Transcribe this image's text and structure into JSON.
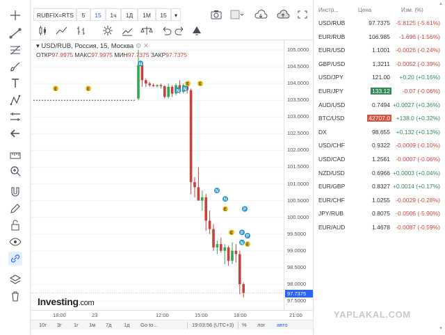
{
  "toolbar": {
    "symbol": "RUBFIX=RTS",
    "intervals": [
      "5",
      "15",
      "1ч",
      "1Д",
      "1М",
      "15"
    ],
    "selected_interval": "15"
  },
  "legend": {
    "title": "USD/RUB, Россия, 15, Москва",
    "open_label": "ОТКР",
    "open": "97.9975",
    "high_label": "МАКС",
    "high": "97.9975",
    "low_label": "МИН",
    "low": "97.7375",
    "close_label": "ЗАКР",
    "close": "97.7375"
  },
  "price_axis": {
    "ticks": [
      "105.0000",
      "104.5000",
      "104.0000",
      "103.5000",
      "103.0000",
      "102.5000",
      "102.0000",
      "101.5000",
      "101.0000",
      "100.5000",
      "100.0000",
      "99.5000",
      "99.0000",
      "98.5000",
      "98.0000",
      "97.5000"
    ],
    "current": "97.7375",
    "current_color": "#2962ff"
  },
  "time_axis": {
    "ticks": [
      "18:00",
      "23",
      "12:00",
      "15:00",
      "18:00",
      "21:00"
    ]
  },
  "bottom_bar": {
    "ranges": [
      "10г",
      "3г",
      "1г",
      "1м",
      "7д",
      "1д",
      "Go to..."
    ],
    "clock": "19:03:56 (UTC+3)",
    "percent": "%",
    "log": "лог",
    "auto": "авто"
  },
  "logo": {
    "name": "Investing",
    "suffix": ".com"
  },
  "events": [
    {
      "kind": "E",
      "color": "#f2c21b"
    },
    {
      "kind": "N",
      "color": "#2196c9"
    },
    {
      "kind": "P",
      "color": "#2196c9"
    }
  ],
  "watchlist": {
    "headers": {
      "symbol": "Инстр...",
      "price": "Цена",
      "change": "Изм. (%)"
    },
    "rows": [
      {
        "symbol": "USD/RUB",
        "price": "97.7375",
        "change": "-5.8125 (-5.61%)",
        "dir": "neg",
        "flash": ""
      },
      {
        "symbol": "EUR/RUB",
        "price": "106.985",
        "change": "-1.696 (-1.56%)",
        "dir": "neg",
        "flash": ""
      },
      {
        "symbol": "EUR/USD",
        "price": "1.1001",
        "change": "-0.0026 (-0.24%)",
        "dir": "neg",
        "flash": ""
      },
      {
        "symbol": "GBP/USD",
        "price": "1.3211",
        "change": "-0.0052 (-0.39%)",
        "dir": "neg",
        "flash": ""
      },
      {
        "symbol": "USD/JPY",
        "price": "121.00",
        "change": "+0.20 (+0.16%)",
        "dir": "pos",
        "flash": ""
      },
      {
        "symbol": "EUR/JPY",
        "price": "133.12",
        "change": "-0.07 (-0.06%)",
        "dir": "neg",
        "flash": "up"
      },
      {
        "symbol": "AUD/USD",
        "price": "0.7494",
        "change": "+0.0027 (+0.36%)",
        "dir": "pos",
        "flash": ""
      },
      {
        "symbol": "BTC/USD",
        "price": "42707.0",
        "change": "+138.0 (+0.32%)",
        "dir": "pos",
        "flash": "down"
      },
      {
        "symbol": "DX",
        "price": "98.655",
        "change": "+0.132 (+0.13%)",
        "dir": "pos",
        "flash": ""
      },
      {
        "symbol": "USD/CHF",
        "price": "0.9322",
        "change": "-0.0009 (-0.10%)",
        "dir": "neg",
        "flash": ""
      },
      {
        "symbol": "USD/CAD",
        "price": "1.2561",
        "change": "-0.0007 (-0.06%)",
        "dir": "neg",
        "flash": ""
      },
      {
        "symbol": "NZD/USD",
        "price": "0.6966",
        "change": "+0.0003 (+0.04%)",
        "dir": "pos",
        "flash": ""
      },
      {
        "symbol": "EUR/GBP",
        "price": "0.8327",
        "change": "+0.0014 (+0.17%)",
        "dir": "pos",
        "flash": ""
      },
      {
        "symbol": "EUR/CHF",
        "price": "1.0255",
        "change": "-0.0029 (-0.28%)",
        "dir": "neg",
        "flash": ""
      },
      {
        "symbol": "JPY/RUB",
        "price": "0.8075",
        "change": "-0.0506 (-5.90%)",
        "dir": "neg",
        "flash": ""
      },
      {
        "symbol": "EUR/AUD",
        "price": "1.4678",
        "change": "-0.0087 (-0.59%)",
        "dir": "neg",
        "flash": ""
      }
    ]
  },
  "watermark": "YAPLAKAL.COM",
  "candles": [
    [
      103.55,
      105.0,
      103.5,
      104.55
    ],
    [
      104.55,
      104.6,
      103.9,
      104.1
    ],
    [
      104.1,
      104.15,
      103.9,
      104.0
    ],
    [
      104.0,
      104.05,
      103.9,
      103.95
    ],
    [
      103.95,
      104.0,
      103.9,
      103.92
    ],
    [
      103.92,
      103.98,
      103.88,
      103.95
    ],
    [
      103.95,
      104.0,
      103.85,
      103.92
    ],
    [
      103.92,
      103.95,
      103.55,
      103.6
    ],
    [
      103.6,
      104.0,
      103.55,
      103.9
    ],
    [
      103.9,
      103.95,
      103.6,
      103.7
    ],
    [
      103.7,
      104.0,
      103.65,
      103.95
    ],
    [
      103.95,
      104.1,
      103.7,
      103.75
    ],
    [
      103.75,
      104.0,
      103.7,
      103.95
    ],
    [
      103.95,
      104.0,
      103.7,
      103.8
    ],
    [
      103.8,
      103.85,
      100.7,
      101.05
    ],
    [
      101.05,
      101.2,
      100.6,
      100.9
    ],
    [
      100.9,
      101.5,
      100.5,
      100.5
    ],
    [
      100.5,
      100.8,
      100.2,
      100.6
    ],
    [
      100.6,
      100.7,
      99.6,
      99.9
    ],
    [
      99.9,
      100.2,
      99.5,
      99.65
    ],
    [
      99.65,
      99.8,
      99.0,
      99.1
    ],
    [
      99.1,
      99.3,
      98.9,
      99.2
    ],
    [
      99.2,
      99.4,
      98.95,
      99.0
    ],
    [
      99.0,
      99.2,
      98.6,
      99.1
    ],
    [
      99.1,
      99.15,
      98.55,
      98.7
    ],
    [
      98.7,
      99.25,
      98.6,
      99.0
    ],
    [
      99.0,
      99.2,
      98.65,
      98.9
    ],
    [
      98.9,
      99.0,
      97.7,
      98.0
    ],
    [
      98.0,
      98.05,
      97.6,
      97.74
    ]
  ]
}
